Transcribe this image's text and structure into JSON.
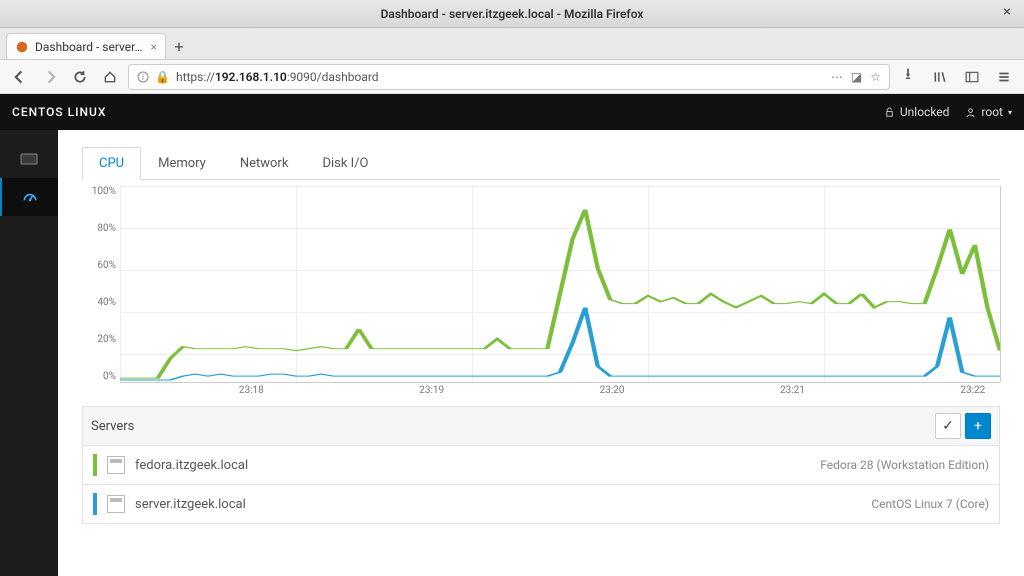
{
  "window": {
    "title": "Dashboard - server.itzgeek.local - Mozilla Firefox"
  },
  "browser_tab": {
    "label": "Dashboard - server.itzgee"
  },
  "url": {
    "scheme": "https://",
    "host": "192.168.1.10",
    "port_path": ":9090/dashboard"
  },
  "cockpit": {
    "brand": "CENTOS LINUX",
    "lock_label": "Unlocked",
    "user": "root"
  },
  "tabs": {
    "t0": "CPU",
    "t1": "Memory",
    "t2": "Network",
    "t3": "Disk I/O"
  },
  "servers_panel_title": "Servers",
  "servers": [
    {
      "name": "fedora.itzgeek.local",
      "os": "Fedora 28 (Workstation Edition)",
      "color": "#7bbf3a"
    },
    {
      "name": "server.itzgeek.local",
      "os": "CentOS Linux 7 (Core)",
      "color": "#2a9fd6"
    }
  ],
  "chart_data": {
    "type": "line",
    "title": "",
    "xlabel": "",
    "ylabel": "",
    "ylim": [
      0,
      100
    ],
    "y_ticks": [
      "100%",
      "80%",
      "60%",
      "40%",
      "20%",
      "0%"
    ],
    "x_ticks": [
      "23:18",
      "23:19",
      "23:20",
      "23:21",
      "23:22"
    ],
    "series": [
      {
        "name": "fedora.itzgeek.local",
        "color": "#7bbf3a",
        "values": [
          2,
          2,
          2,
          2,
          12,
          18,
          17,
          17,
          17,
          17,
          18,
          17,
          17,
          17,
          16,
          17,
          18,
          17,
          17,
          27,
          17,
          17,
          17,
          17,
          17,
          17,
          17,
          17,
          17,
          17,
          22,
          17,
          17,
          17,
          17,
          45,
          73,
          88,
          58,
          42,
          40,
          40,
          44,
          41,
          43,
          40,
          40,
          45,
          41,
          38,
          41,
          44,
          40,
          40,
          41,
          40,
          45,
          40,
          40,
          45,
          38,
          41,
          41,
          40,
          40,
          58,
          78,
          55,
          70,
          38,
          16
        ]
      },
      {
        "name": "server.itzgeek.local",
        "color": "#2a9fd6",
        "values": [
          1,
          1,
          1,
          1,
          1,
          3,
          4,
          3,
          4,
          3,
          3,
          3,
          4,
          4,
          3,
          3,
          4,
          3,
          3,
          3,
          3,
          3,
          3,
          3,
          3,
          3,
          3,
          3,
          3,
          3,
          3,
          3,
          3,
          3,
          3,
          5,
          20,
          38,
          8,
          3,
          3,
          3,
          3,
          3,
          3,
          3,
          3,
          3,
          3,
          3,
          3,
          3,
          3,
          3,
          3,
          3,
          3,
          3,
          3,
          3,
          3,
          3,
          3,
          3,
          3,
          8,
          33,
          5,
          3,
          3,
          3
        ]
      }
    ]
  }
}
